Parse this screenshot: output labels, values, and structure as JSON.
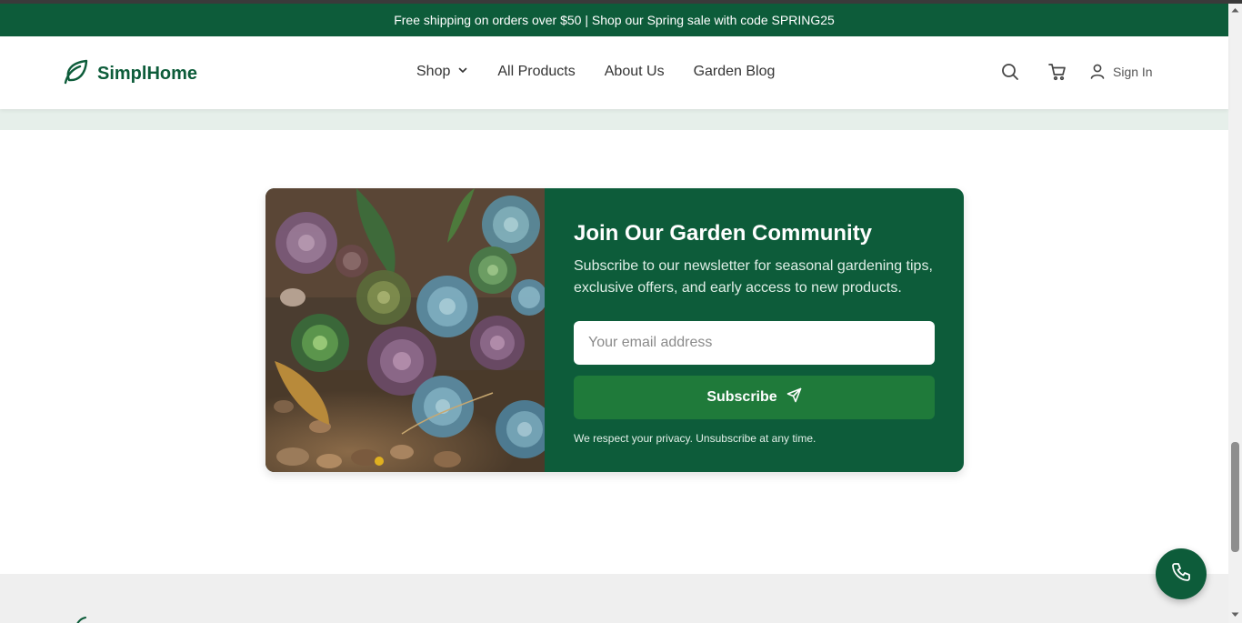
{
  "promo": {
    "text": "Free shipping on orders over $50 | Shop our Spring sale with code SPRING25"
  },
  "header": {
    "logo": "SimplHome",
    "nav": [
      {
        "label": "Shop",
        "has_dropdown": true
      },
      {
        "label": "All Products"
      },
      {
        "label": "About Us"
      },
      {
        "label": "Garden Blog"
      }
    ],
    "icons": [
      "search-icon",
      "cart-icon",
      "user-icon"
    ],
    "signin": "Sign In"
  },
  "newsletter": {
    "image_alt": "succulents",
    "title": "Join Our Garden Community",
    "description": "Subscribe to our newsletter for seasonal gardening tips, exclusive offers, and early access to new products.",
    "email_placeholder": "Your email address",
    "button": "Subscribe",
    "privacy": "We respect your privacy. Unsubscribe at any time."
  },
  "colors": {
    "brand": "#0d5c3a",
    "button": "#1f7a3a",
    "band": "#e6efea",
    "footer": "#efefef"
  }
}
